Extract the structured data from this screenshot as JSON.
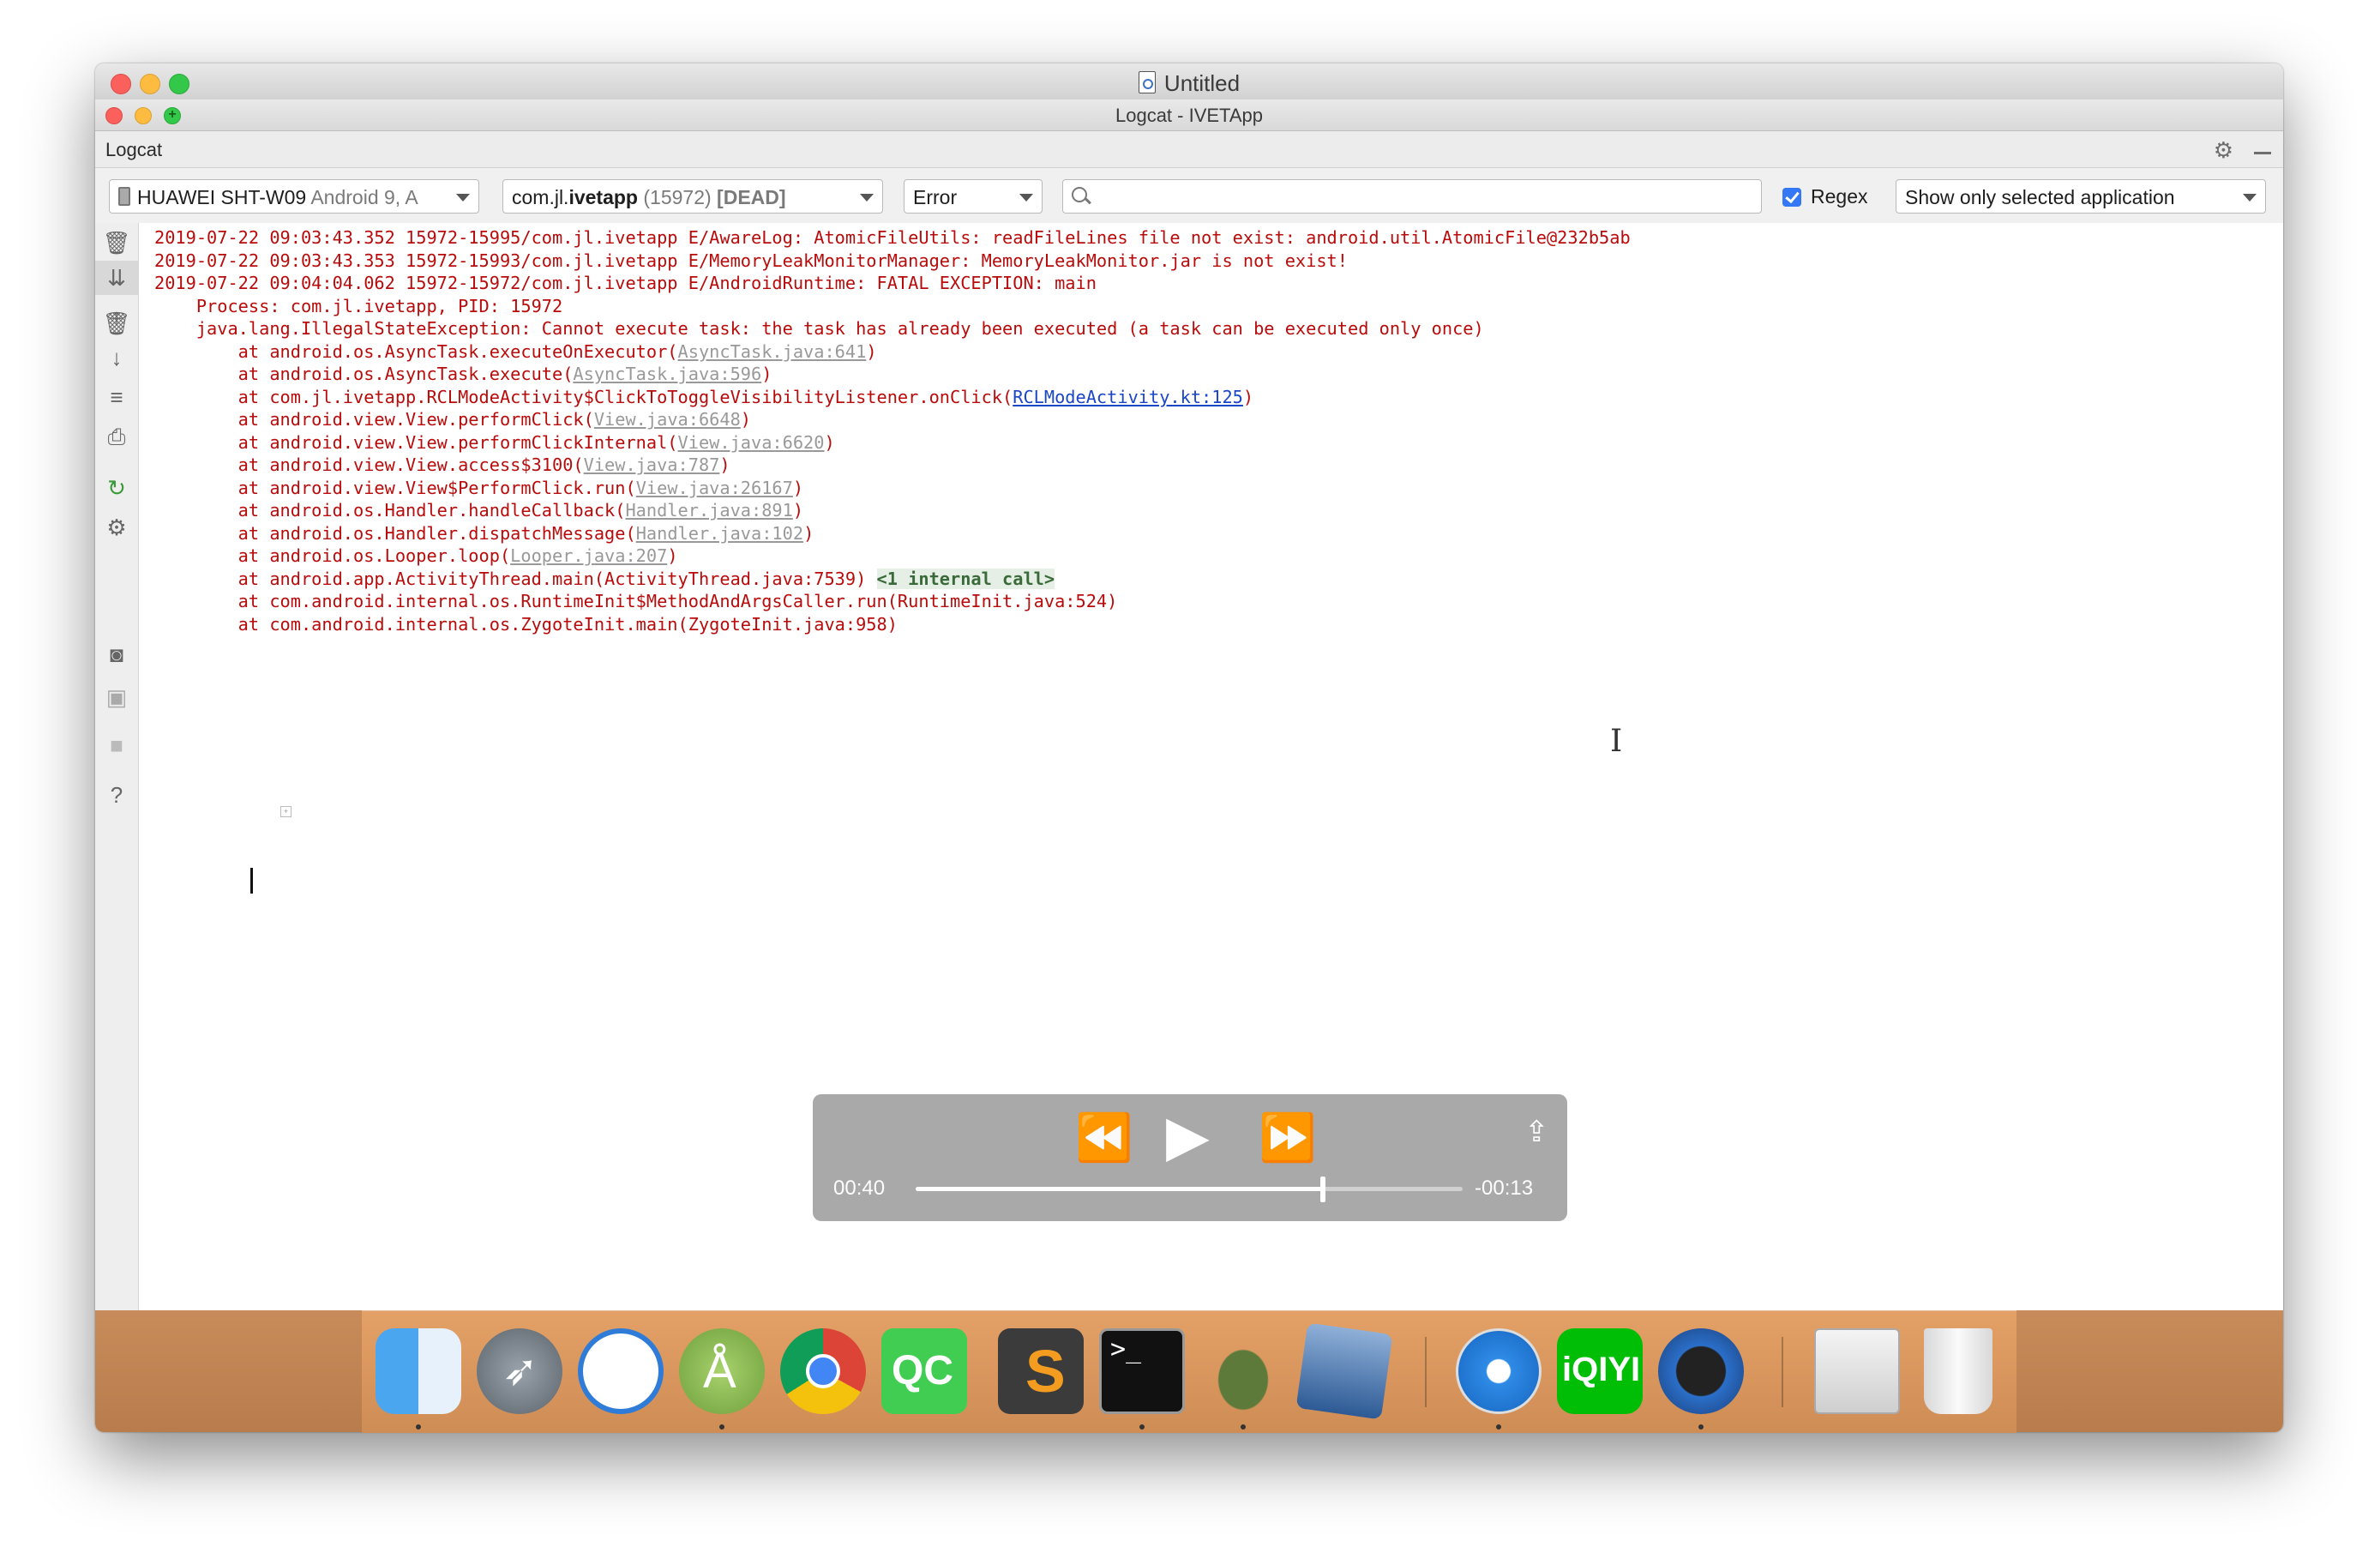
{
  "window": {
    "doc_title": "Untitled",
    "inner_title": "Logcat - IVETApp"
  },
  "panel": {
    "title": "Logcat"
  },
  "toolbar": {
    "device_name": "HUAWEI SHT-W09",
    "device_os": "Android 9, A",
    "process_name_prefix": "com.jl.",
    "process_name_bold": "ivetapp",
    "process_pid": "(15972)",
    "process_state": "[DEAD]",
    "level": "Error",
    "search_value": "",
    "regex_label": "Regex",
    "regex_checked": true,
    "filter": "Show only selected application"
  },
  "sidebar_icons": [
    "trash-icon",
    "scroll-to-end-icon",
    "up-arrow-icon",
    "down-arrow-icon",
    "soft-wrap-icon",
    "print-icon",
    "restart-icon",
    "settings-icon",
    "screenshot-icon",
    "screen-record-icon",
    "stop-icon",
    "help-icon"
  ],
  "log": {
    "lines": [
      {
        "text": "2019-07-22 09:03:43.352 15972-15995/com.jl.ivetapp E/AwareLog: AtomicFileUtils: readFileLines file not exist: android.util.AtomicFile@232b5ab"
      },
      {
        "text": "2019-07-22 09:03:43.353 15972-15993/com.jl.ivetapp E/MemoryLeakMonitorManager: MemoryLeakMonitor.jar is not exist!"
      },
      {
        "text": "2019-07-22 09:04:04.062 15972-15972/com.jl.ivetapp E/AndroidRuntime: FATAL EXCEPTION: main"
      },
      {
        "text": "    Process: com.jl.ivetapp, PID: 15972"
      },
      {
        "text": "    java.lang.IllegalStateException: Cannot execute task: the task has already been executed (a task can be executed only once)"
      },
      {
        "text": "        at android.os.AsyncTask.executeOnExecutor(",
        "link": "AsyncTask.java:641",
        "after": ")"
      },
      {
        "text": "        at android.os.AsyncTask.execute(",
        "link": "AsyncTask.java:596",
        "after": ")"
      },
      {
        "text": "        at com.jl.ivetapp.RCLModeActivity$ClickToToggleVisibilityListener.onClick(",
        "link_blue": "RCLModeActivity.kt:125",
        "after": ")"
      },
      {
        "text": "        at android.view.View.performClick(",
        "link": "View.java:6648",
        "after": ")"
      },
      {
        "text": "        at android.view.View.performClickInternal(",
        "link": "View.java:6620",
        "after": ")"
      },
      {
        "text": "        at android.view.View.access$3100(",
        "link": "View.java:787",
        "after": ")"
      },
      {
        "text": "        at android.view.View$PerformClick.run(",
        "link": "View.java:26167",
        "after": ")"
      },
      {
        "text": "        at android.os.Handler.handleCallback(",
        "link": "Handler.java:891",
        "after": ")"
      },
      {
        "text": "        at android.os.Handler.dispatchMessage(",
        "link": "Handler.java:102",
        "after": ")"
      },
      {
        "text": "        at android.os.Looper.loop(",
        "link": "Looper.java:207",
        "after": ")"
      },
      {
        "text": "        at android.app.ActivityThread.main(ActivityThread.java:7539) ",
        "internal": "<1 internal call>"
      },
      {
        "text": "        at com.android.internal.os.RuntimeInit$MethodAndArgsCaller.run(RuntimeInit.java:524)"
      },
      {
        "text": "        at com.android.internal.os.ZygoteInit.main(ZygoteInit.java:958)"
      }
    ]
  },
  "player": {
    "elapsed": "00:40",
    "remaining": "-00:13",
    "progress": 0.745
  },
  "dock": {
    "apps": [
      "finder-icon",
      "launchpad-icon",
      "mail-icon",
      "android-studio-icon",
      "chrome-icon",
      "qt-creator-icon",
      "sublime-text-icon",
      "terminal-icon",
      "turtle-app-icon",
      "virtualbox-icon",
      "safari-icon",
      "iqiyi-icon",
      "quicktime-icon",
      "documents-stack-icon",
      "trash-can-icon"
    ],
    "qc_label": "QC",
    "iqiyi_label": "iQIYI",
    "terminal_label": ">_"
  }
}
